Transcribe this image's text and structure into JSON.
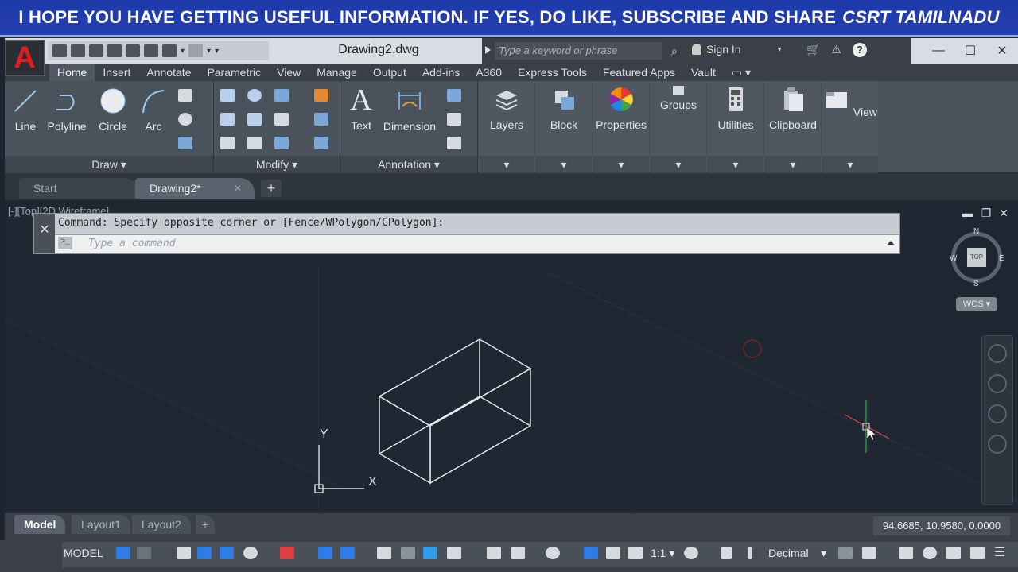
{
  "banner": {
    "text": "I HOPE YOU HAVE GETTING USEFUL INFORMATION. IF YES, DO LIKE, SUBSCRIBE AND SHARE",
    "brand": "CSRT TAMILNADU"
  },
  "titlebar": {
    "app_letter": "A",
    "document_title": "Drawing2.dwg",
    "search_placeholder": "Type a keyword or phrase",
    "sign_in": "Sign In"
  },
  "menu_tabs": [
    "Home",
    "Insert",
    "Annotate",
    "Parametric",
    "View",
    "Manage",
    "Output",
    "Add-ins",
    "A360",
    "Express Tools",
    "Featured Apps",
    "Vault"
  ],
  "ribbon": {
    "draw": {
      "line": "Line",
      "polyline": "Polyline",
      "circle": "Circle",
      "arc": "Arc",
      "title": "Draw"
    },
    "modify": {
      "title": "Modify"
    },
    "annotation": {
      "text": "Text",
      "dimension": "Dimension",
      "title": "Annotation"
    },
    "layers": "Layers",
    "block": "Block",
    "properties": "Properties",
    "groups": "Groups",
    "utilities": "Utilities",
    "clipboard": "Clipboard",
    "view": "View"
  },
  "file_tabs": {
    "start": "Start",
    "drawing": "Drawing2*"
  },
  "viewport": {
    "label": "[-][Top][2D Wireframe]",
    "command_history": "Command: Specify opposite corner or [Fence/WPolygon/CPolygon]:",
    "command_placeholder": "Type a command",
    "viewcube": {
      "n": "N",
      "s": "S",
      "e": "E",
      "w": "W",
      "face": "TOP",
      "wcs": "WCS"
    },
    "ucs": {
      "x": "X",
      "y": "Y"
    }
  },
  "layout_tabs": [
    "Model",
    "Layout1",
    "Layout2"
  ],
  "status": {
    "coords": "94.6685, 10.9580, 0.0000",
    "model": "MODEL",
    "scale": "1:1",
    "units": "Decimal"
  },
  "colors": {
    "banner_bg": "#2140b0",
    "ribbon_bg": "#4a525c",
    "canvas_bg": "#1e2732",
    "accent_blue": "#2e7ce6"
  }
}
